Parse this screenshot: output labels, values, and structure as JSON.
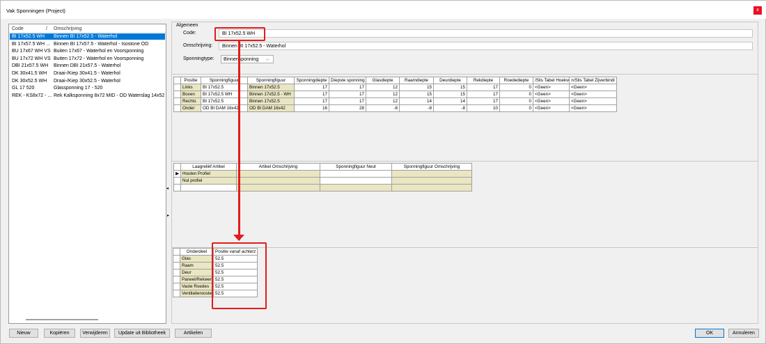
{
  "window": {
    "title": "Vak Sponningen (Project)",
    "close_glyph": "x"
  },
  "list": {
    "headers": {
      "code": "Code",
      "sep": "/",
      "desc": "Omschrijving"
    },
    "rows": [
      {
        "code": "BI 17x52.5 WH",
        "desc": "Binnen BI 17x52.5 - Waterhol",
        "selected": true
      },
      {
        "code": "BI 17x57.5 WH ...",
        "desc": "Binnen BI 17x57.5 - Waterhol - Isostone OD",
        "selected": false
      },
      {
        "code": "BU 17x67 WH VS",
        "desc": "Buiten 17x67 - Waterhol en Voorsponning",
        "selected": false
      },
      {
        "code": "BU 17x72 WH VS",
        "desc": "Buiten 17x72 - Waterhol en Voorsponning",
        "selected": false
      },
      {
        "code": "DBI 21x57.5 WH",
        "desc": "Binnen DBI 21x57.5 - Waterhol",
        "selected": false
      },
      {
        "code": "DK 30x41.5 WH",
        "desc": "Draai-/Kiep 30x41.5 - Waterhol",
        "selected": false
      },
      {
        "code": "DK 30x52.5 WH",
        "desc": "Draai-/Kiep 30x52.5 - Waterhol",
        "selected": false
      },
      {
        "code": "GL 17 520",
        "desc": "Glassponning 17 - 520",
        "selected": false
      },
      {
        "code": "REK - KS8x72 - ...",
        "desc": "Rek Kalksponning 8x72 MID - OD Waterslag 14x52",
        "selected": false
      }
    ]
  },
  "algemeen": {
    "group_label": "Algemeen",
    "code_label": "Code:",
    "code_value": "BI 17x52.5 WH",
    "omschrijving_label": "Omschrijving:",
    "omschrijving_value": "Binnen BI 17x52.5 - Waterhol",
    "type_label": "Sponningtype:",
    "type_value": "Binnensponning"
  },
  "positions_table": {
    "headers": [
      "Positie",
      "Sponningfiguur",
      "Sponningfiguur",
      "Sponningdiepte",
      "Diepste sponning",
      "Glasdiepte",
      "Raamdiepte",
      "Deurdiepte",
      "Rekdiepte",
      "Roedediepte",
      "/Slis Tabel Hoekverbin",
      "n/Slis Tabel Zijverbindi"
    ],
    "rows": [
      [
        "Links",
        "BI 17x52.5",
        "Binnen 17x52.5",
        "17",
        "17",
        "12",
        "15",
        "15",
        "17",
        "0",
        "<Geen>",
        "<Geen>"
      ],
      [
        "Boven",
        "BI 17x52.5 WH",
        "Binnen 17x52.5 - WH",
        "17",
        "17",
        "12",
        "15",
        "15",
        "17",
        "0",
        "<Geen>",
        "<Geen>"
      ],
      [
        "Rechts",
        "BI 17x52.5",
        "Binnen 17x52.5",
        "17",
        "17",
        "12",
        "14",
        "14",
        "17",
        "0",
        "<Geen>",
        "<Geen>"
      ],
      [
        "Onder",
        "OD BI DAM 16x42",
        "OD BI DAM 16x42",
        "16",
        "28",
        "-8",
        "-8",
        "-8",
        "10",
        "0",
        "<Geen>",
        "<Geen>"
      ]
    ]
  },
  "artikel_table": {
    "headers": [
      "Laagreliëf Artikel",
      "Artikel Omschrijving",
      "Sponningfiguur Neut",
      "Sponningfiguur Omschrijving"
    ],
    "rows": [
      [
        "Houten Profiel",
        "",
        "",
        ""
      ],
      [
        "Nul profiel",
        "",
        "",
        ""
      ],
      [
        "",
        "",
        "",
        ""
      ]
    ],
    "row_marker": "▶"
  },
  "onderdeel_table": {
    "headers": [
      "Onderdeel",
      "Positie vanaf achterz"
    ],
    "rows": [
      [
        "Glas",
        "52.5"
      ],
      [
        "Raam",
        "52.5"
      ],
      [
        "Deur",
        "52.5"
      ],
      [
        "Paneel/Rekwerk",
        "52.5"
      ],
      [
        "Vaste Roedes",
        "52.5"
      ],
      [
        "Ventilatierooster",
        "52.5"
      ]
    ]
  },
  "splitter": {
    "right_arrow": "▸",
    "left_arrow": "◂"
  },
  "buttons": {
    "nieuw": "Nieuw",
    "kopieren": "Kopiëren",
    "verwijderen": "Verwijderen",
    "update": "Update uit Bibliotheek",
    "artikelen": "Artikelen",
    "ok": "OK",
    "annuleren": "Annuleren"
  },
  "colors": {
    "highlight_cell": "#e9e6c2",
    "selection": "#0078d7",
    "annotation": "#e31b1b"
  }
}
